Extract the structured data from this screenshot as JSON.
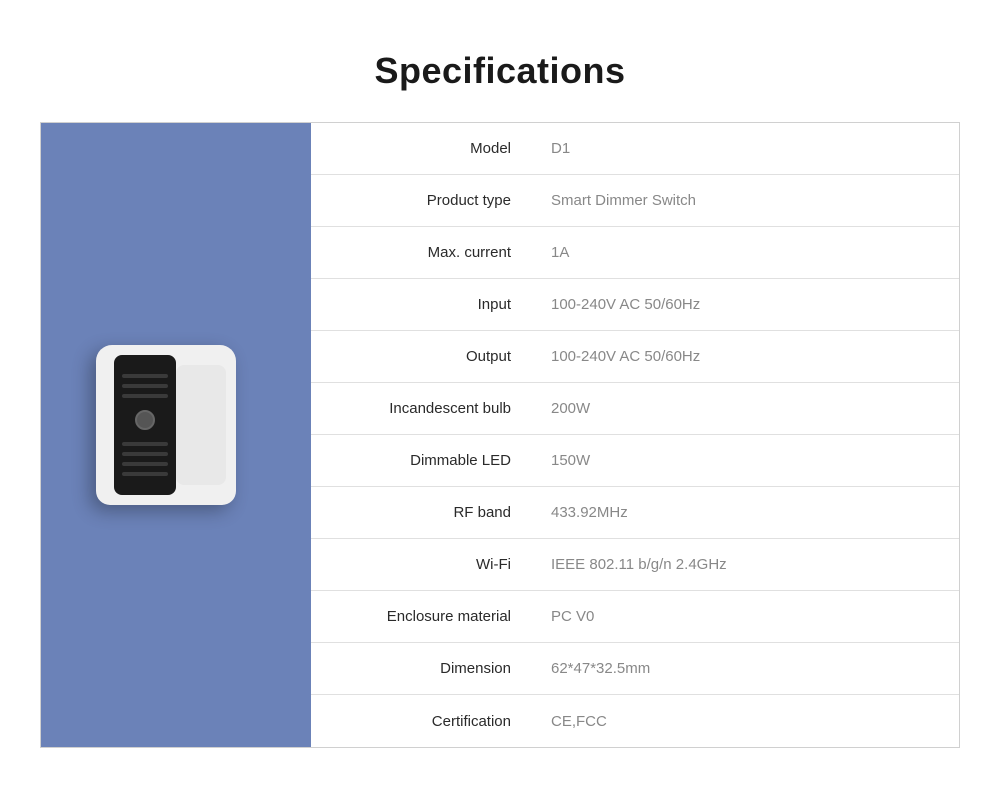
{
  "page": {
    "title": "Specifications"
  },
  "product": {
    "image_alt": "Smart Dimmer Switch D1 product photo"
  },
  "specs": [
    {
      "label": "Model",
      "value": "D1"
    },
    {
      "label": "Product type",
      "value": "Smart Dimmer Switch"
    },
    {
      "label": "Max. current",
      "value": "1A"
    },
    {
      "label": "Input",
      "value": "100-240V AC 50/60Hz"
    },
    {
      "label": "Output",
      "value": "100-240V AC 50/60Hz"
    },
    {
      "label": "Incandescent bulb",
      "value": "200W"
    },
    {
      "label": "Dimmable LED",
      "value": "150W"
    },
    {
      "label": "RF band",
      "value": "433.92MHz"
    },
    {
      "label": "Wi-Fi",
      "value": "IEEE 802.11 b/g/n 2.4GHz"
    },
    {
      "label": "Enclosure material",
      "value": "PC V0"
    },
    {
      "label": "Dimension",
      "value": "62*47*32.5mm"
    },
    {
      "label": "Certification",
      "value": "CE,FCC"
    }
  ]
}
